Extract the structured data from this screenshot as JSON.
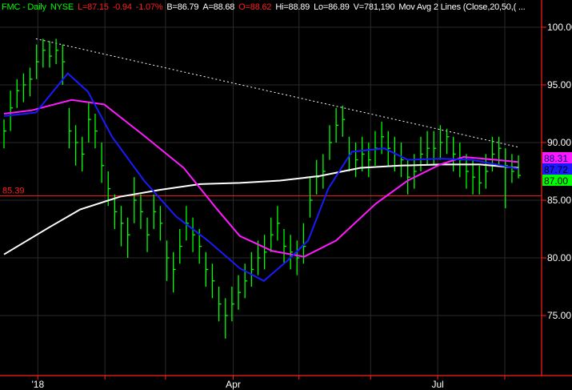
{
  "header": {
    "symbol": "FMC - Daily",
    "exchange": "NYSE",
    "last": "L=87.15",
    "change": "-0.94",
    "change_pct": "-1.07%",
    "bid": "B=86.79",
    "ask": "A=88.68",
    "open": "O=88.62",
    "high": "Hi=88.89",
    "low": "Lo=86.89",
    "volume": "V=781,190",
    "study": "Mov Avg 2 Lines (Close,20,50,( ..."
  },
  "colors": {
    "bars": "#00ff00",
    "ma20": "#1a1aff",
    "ma50": "#ff1aff",
    "ma200": "#ffffff",
    "support": "#ff2020",
    "trend": "#ffffff"
  },
  "chart_data": {
    "type": "ohlc",
    "ylim": [
      71.5,
      102.3
    ],
    "y_ticks": [
      "100.00",
      "95.00",
      "90.00",
      "85.00",
      "80.00",
      "75.00"
    ],
    "y_tick_values": [
      100,
      95,
      90,
      85,
      80,
      75
    ],
    "x_ticks": [
      {
        "label": "'18",
        "index": 5.2
      },
      {
        "label": "Apr",
        "index": 35.2
      },
      {
        "label": "Jul",
        "index": 66.6
      }
    ],
    "grid_indices": [
      5.2,
      15.5,
      24.8,
      35.2,
      45.3,
      56.3,
      66.6,
      76.9
    ],
    "bars_hlc": [
      [
        92,
        89.5,
        91
      ],
      [
        94.5,
        91,
        93
      ],
      [
        95.5,
        93,
        94.5
      ],
      [
        96,
        93.5,
        95
      ],
      [
        96.5,
        94,
        95.5
      ],
      [
        98.5,
        95.5,
        97
      ],
      [
        99,
        96.5,
        98
      ],
      [
        98.8,
        96.5,
        97.5
      ],
      [
        99,
        96.8,
        98
      ],
      [
        98.5,
        95,
        97
      ],
      [
        93,
        89.5,
        91
      ],
      [
        91.5,
        88,
        90
      ],
      [
        90.5,
        87.5,
        89
      ],
      [
        93.5,
        90,
        92
      ],
      [
        92.5,
        89.5,
        91
      ],
      [
        90,
        86.5,
        88
      ],
      [
        87.5,
        84.5,
        86
      ],
      [
        85.5,
        82.5,
        84
      ],
      [
        84.5,
        81,
        83
      ],
      [
        83.5,
        80,
        82
      ],
      [
        87,
        83,
        85
      ],
      [
        85.5,
        82.5,
        84
      ],
      [
        83.5,
        80.5,
        82
      ],
      [
        85.5,
        82.5,
        84
      ],
      [
        84.5,
        81.5,
        83
      ],
      [
        81.5,
        78,
        80
      ],
      [
        80.5,
        77,
        79
      ],
      [
        82.5,
        79.5,
        81
      ],
      [
        84.5,
        81.5,
        83
      ],
      [
        83.5,
        80.5,
        82
      ],
      [
        82.5,
        79.5,
        81
      ],
      [
        80.5,
        77.5,
        79
      ],
      [
        79.5,
        76.5,
        78
      ],
      [
        77.5,
        74.5,
        76
      ],
      [
        76.5,
        73,
        75
      ],
      [
        77.5,
        74.5,
        76
      ],
      [
        78.5,
        75.5,
        77
      ],
      [
        79.5,
        76.5,
        78
      ],
      [
        80.5,
        77.5,
        79
      ],
      [
        81.5,
        78.5,
        80
      ],
      [
        82,
        79,
        80.5
      ],
      [
        83.5,
        80.5,
        82
      ],
      [
        84.5,
        81.5,
        83
      ],
      [
        82.5,
        79.5,
        81
      ],
      [
        82,
        79,
        80.5
      ],
      [
        81.5,
        78.5,
        80
      ],
      [
        83,
        79.5,
        81
      ],
      [
        87,
        83.5,
        85
      ],
      [
        88.5,
        85.5,
        87
      ],
      [
        89,
        86,
        87.5
      ],
      [
        91.5,
        88.5,
        90
      ],
      [
        93,
        90,
        91.5
      ],
      [
        93.2,
        90.5,
        92
      ],
      [
        90.5,
        87.5,
        89
      ],
      [
        90,
        87,
        88.5
      ],
      [
        90.5,
        87.5,
        89
      ],
      [
        90,
        87,
        88.5
      ],
      [
        91,
        88,
        89.5
      ],
      [
        91.8,
        89,
        90.5
      ],
      [
        91,
        88,
        89.5
      ],
      [
        90.5,
        87.5,
        89
      ],
      [
        90,
        87,
        88.5
      ],
      [
        88.5,
        85.5,
        87
      ],
      [
        89,
        86,
        87.5
      ],
      [
        90.5,
        87.5,
        89
      ],
      [
        91,
        88,
        89.5
      ],
      [
        91,
        88,
        89.5
      ],
      [
        91.5,
        88.5,
        90
      ],
      [
        91.2,
        89,
        90.5
      ],
      [
        90.5,
        87.5,
        89
      ],
      [
        90,
        87,
        88.5
      ],
      [
        89,
        86,
        87.5
      ],
      [
        88.5,
        85.5,
        87
      ],
      [
        88,
        85.5,
        86.5
      ],
      [
        89,
        86,
        87.5
      ],
      [
        90.5,
        87.5,
        89
      ],
      [
        90.5,
        88,
        89.5
      ],
      [
        89.5,
        84.3,
        88
      ],
      [
        89,
        86.5,
        87.5
      ],
      [
        88.89,
        86.89,
        87.15
      ]
    ],
    "ma20": [
      [
        0,
        92.3
      ],
      [
        4.9,
        92.6
      ],
      [
        9.8,
        96
      ],
      [
        12.9,
        94.4
      ],
      [
        16.6,
        90.5
      ],
      [
        21.5,
        86.7
      ],
      [
        26.4,
        83.6
      ],
      [
        31.3,
        81.5
      ],
      [
        36.2,
        79.1
      ],
      [
        39.9,
        78
      ],
      [
        43.6,
        79.8
      ],
      [
        46.7,
        81.5
      ],
      [
        49.8,
        86
      ],
      [
        53.4,
        89.2
      ],
      [
        58.4,
        89.5
      ],
      [
        62,
        88.5
      ],
      [
        67,
        88.6
      ],
      [
        71.9,
        88.5
      ],
      [
        75.6,
        88.1
      ],
      [
        79,
        87.72
      ]
    ],
    "ma50": [
      [
        0,
        92.5
      ],
      [
        4.3,
        92.8
      ],
      [
        10.4,
        93.7
      ],
      [
        15.4,
        93.3
      ],
      [
        21.5,
        90.6
      ],
      [
        27.6,
        87.8
      ],
      [
        32.6,
        84.3
      ],
      [
        36.2,
        81.9
      ],
      [
        41.2,
        80.6
      ],
      [
        46.1,
        80.1
      ],
      [
        51,
        81.5
      ],
      [
        57.1,
        84.7
      ],
      [
        62,
        86.7
      ],
      [
        67,
        88.1
      ],
      [
        70.6,
        88.75
      ],
      [
        75.6,
        88.5
      ],
      [
        79,
        88.31
      ]
    ],
    "ma200": [
      [
        0,
        80.3
      ],
      [
        6.8,
        82.6
      ],
      [
        11.7,
        84.2
      ],
      [
        17.8,
        85.3
      ],
      [
        24,
        85.9
      ],
      [
        30.1,
        86.4
      ],
      [
        36.2,
        86.5
      ],
      [
        42.4,
        86.7
      ],
      [
        48.5,
        87.1
      ],
      [
        54.7,
        87.8
      ],
      [
        60.8,
        88
      ],
      [
        67,
        88.1
      ],
      [
        73.1,
        88.1
      ],
      [
        79,
        87.8
      ]
    ],
    "trendline": [
      [
        4.9,
        99.0
      ],
      [
        79,
        89.6
      ]
    ],
    "support": {
      "value": 85.39,
      "label": "85.39"
    },
    "price_tags": [
      {
        "label": "88.31",
        "value": 88.31,
        "color": "#ff1aff",
        "text": "#000080"
      },
      {
        "label": "87.72",
        "value": 87.72,
        "color": "#1a1aff",
        "text": "#000"
      },
      {
        "label": "87.00",
        "value": 87.0,
        "color": "#00ff00",
        "text": "#000"
      }
    ]
  }
}
